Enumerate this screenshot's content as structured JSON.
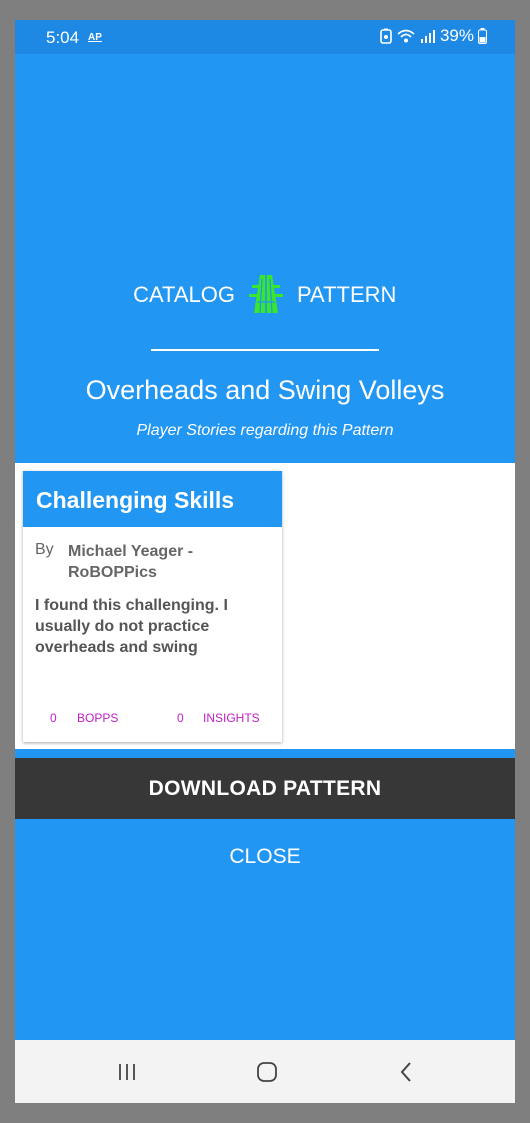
{
  "status_bar": {
    "time": "5:04",
    "app_badge": "AP",
    "battery": "39%"
  },
  "brand": {
    "left_label": "CATALOG",
    "right_label": "PATTERN",
    "logo_color": "#39e62e"
  },
  "header": {
    "title": "Overheads and Swing Volleys",
    "subtitle": "Player Stories regarding this Pattern"
  },
  "story_card": {
    "title": "Challenging Skills",
    "by_label": "By",
    "author": "Michael Yeager - RoBOPPics",
    "text": "I found this challenging. I usually do not practice overheads and swing",
    "bopps_count": "0",
    "bopps_label": "BOPPS",
    "insights_count": "0",
    "insights_label": "INSIGHTS"
  },
  "actions": {
    "download_label": "DOWNLOAD PATTERN",
    "close_label": "CLOSE"
  },
  "nav": {
    "icons": [
      "recent-apps-icon",
      "home-icon",
      "back-icon"
    ]
  },
  "colors": {
    "primary": "#2196f3",
    "status_bar": "#1e88e5",
    "dark_button": "#373737",
    "accent_text": "#c020c8"
  }
}
